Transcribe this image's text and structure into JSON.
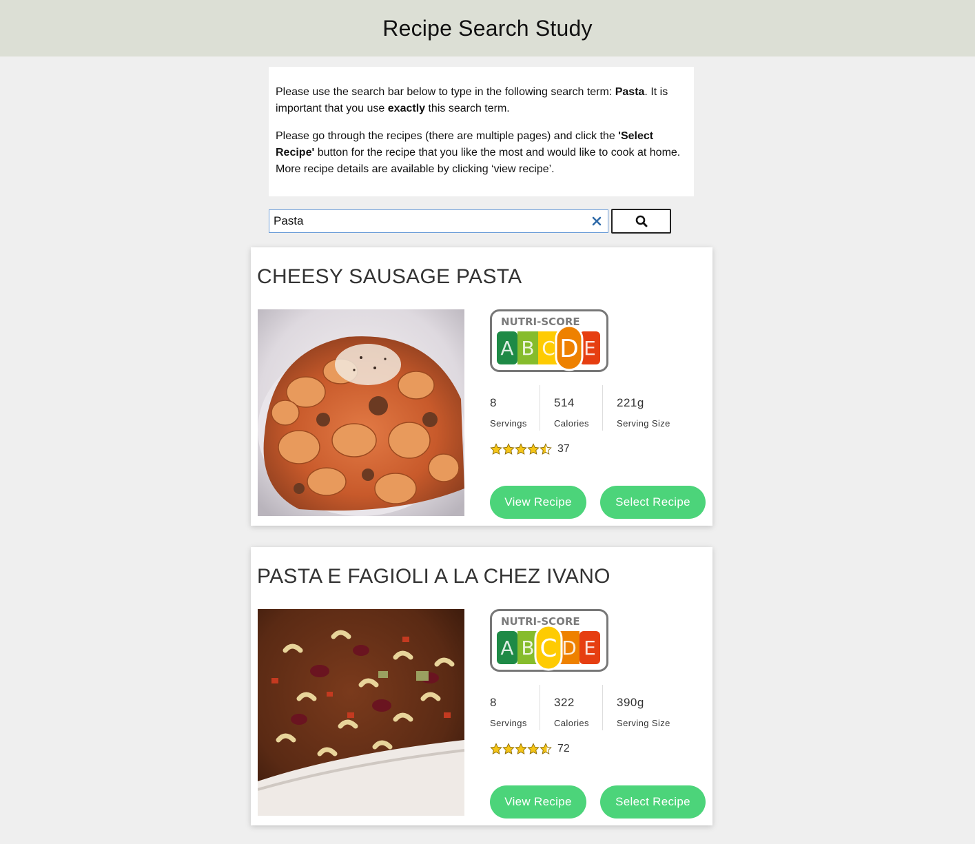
{
  "header": {
    "title": "Recipe Search Study"
  },
  "instructions": {
    "p1_a": "Please use the search bar below to type in the following search term: ",
    "p1_term": "Pasta",
    "p1_b": ". It is important that you use ",
    "p1_exactly": "exactly",
    "p1_c": " this search term.",
    "p2_a": "Please go through the recipes (there are multiple pages) and click the ",
    "p2_btn": "'Select Recipe'",
    "p2_b": " button for the recipe that you like the most and would like to cook at home. More recipe details are available by clicking ‘view recipe’."
  },
  "search": {
    "value": "Pasta"
  },
  "nutri_logo": {
    "title": "NUTRI-SCORE",
    "letters": [
      "A",
      "B",
      "C",
      "D",
      "E"
    ],
    "colors": [
      "#1e8a46",
      "#86bc2c",
      "#fecb02",
      "#ee8100",
      "#e63e11"
    ]
  },
  "recipes": [
    {
      "title": "CHEESY SAUSAGE PASTA",
      "nutri_score": "D",
      "servings": "8",
      "servings_label": "Servings",
      "calories": "514",
      "calories_label": "Calories",
      "serving_size": "221g",
      "serving_size_label": "Serving Size",
      "rating": 4.5,
      "rating_count": "37",
      "view_label": "View Recipe",
      "select_label": "Select Recipe"
    },
    {
      "title": "PASTA E FAGIOLI A LA CHEZ IVANO",
      "nutri_score": "C",
      "servings": "8",
      "servings_label": "Servings",
      "calories": "322",
      "calories_label": "Calories",
      "serving_size": "390g",
      "serving_size_label": "Serving Size",
      "rating": 4.6,
      "rating_count": "72",
      "view_label": "View Recipe",
      "select_label": "Select Recipe"
    }
  ]
}
